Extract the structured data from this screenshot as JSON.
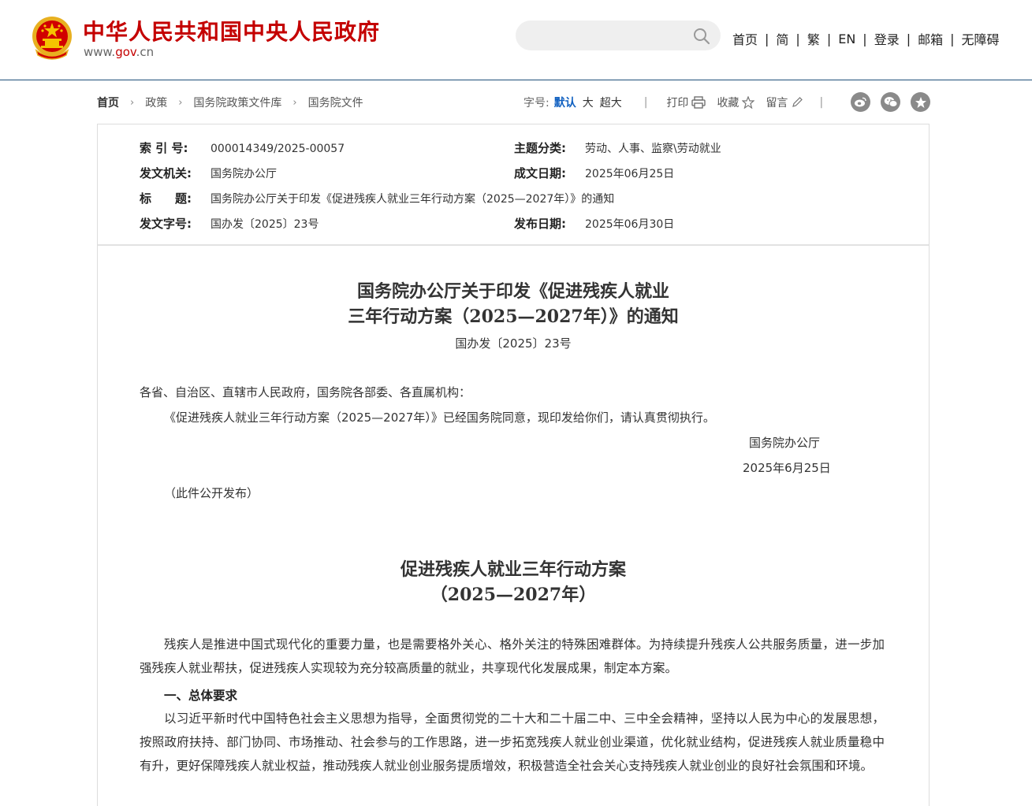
{
  "header": {
    "site_name": "中华人民共和国中央人民政府",
    "domain_prefix": "www.",
    "domain_mid": "gov",
    "domain_suffix": ".cn",
    "search_placeholder": "",
    "nav": [
      "首页",
      "简",
      "繁",
      "EN",
      "登录",
      "邮箱",
      "无障碍"
    ]
  },
  "breadcrumb": [
    "首页",
    "政策",
    "国务院政策文件库",
    "国务院文件"
  ],
  "tools": {
    "font_size_label": "字号:",
    "font_sizes": [
      "默认",
      "大",
      "超大"
    ],
    "print": "打印",
    "favorite": "收藏",
    "comment": "留言"
  },
  "meta": {
    "index_label": "索 引 号:",
    "index_value": "000014349/2025-00057",
    "topic_label": "主题分类:",
    "topic_value": "劳动、人事、监察\\劳动就业",
    "issuer_label": "发文机关:",
    "issuer_value": "国务院办公厅",
    "written_label": "成文日期:",
    "written_value": "2025年06月25日",
    "title_label": "标　　题:",
    "title_value": "国务院办公厅关于印发《促进残疾人就业三年行动方案（2025—2027年）》的通知",
    "docno_label": "发文字号:",
    "docno_value": "国办发〔2025〕23号",
    "published_label": "发布日期:",
    "published_value": "2025年06月30日"
  },
  "article": {
    "title_line1": "国务院办公厅关于印发《促进残疾人就业",
    "title_line2": "三年行动方案（2025—2027年）》的通知",
    "doc_number": "国办发〔2025〕23号",
    "addressee": "各省、自治区、直辖市人民政府，国务院各部委、各直属机构：",
    "body": "《促进残疾人就业三年行动方案（2025—2027年）》已经国务院同意，现印发给你们，请认真贯彻执行。",
    "signature": "国务院办公厅",
    "date": "2025年6月25日",
    "note": "（此件公开发布）",
    "plan_title_line1": "促进残疾人就业三年行动方案",
    "plan_title_line2": "（2025—2027年）",
    "intro": "残疾人是推进中国式现代化的重要力量，也是需要格外关心、格外关注的特殊困难群体。为持续提升残疾人公共服务质量，进一步加强残疾人就业帮扶，促进残疾人实现较为充分较高质量的就业，共享现代化发展成果，制定本方案。",
    "section1_heading": "一、总体要求",
    "section1_text": "以习近平新时代中国特色社会主义思想为指导，全面贯彻党的二十大和二十届二中、三中全会精神，坚持以人民为中心的发展思想，按照政府扶持、部门协同、市场推动、社会参与的工作思路，进一步拓宽残疾人就业创业渠道，优化就业结构，促进残疾人就业质量稳中有升，更好保障残疾人就业权益，推动残疾人就业创业服务提质增效，积极营造全社会关心支持残疾人就业创业的良好社会氛围和环境。"
  },
  "colors": {
    "brand_red": "#c40000",
    "emblem_gold": "#e8b020",
    "header_rule": "#1f4e79",
    "active_font_size": "#1060c0"
  }
}
